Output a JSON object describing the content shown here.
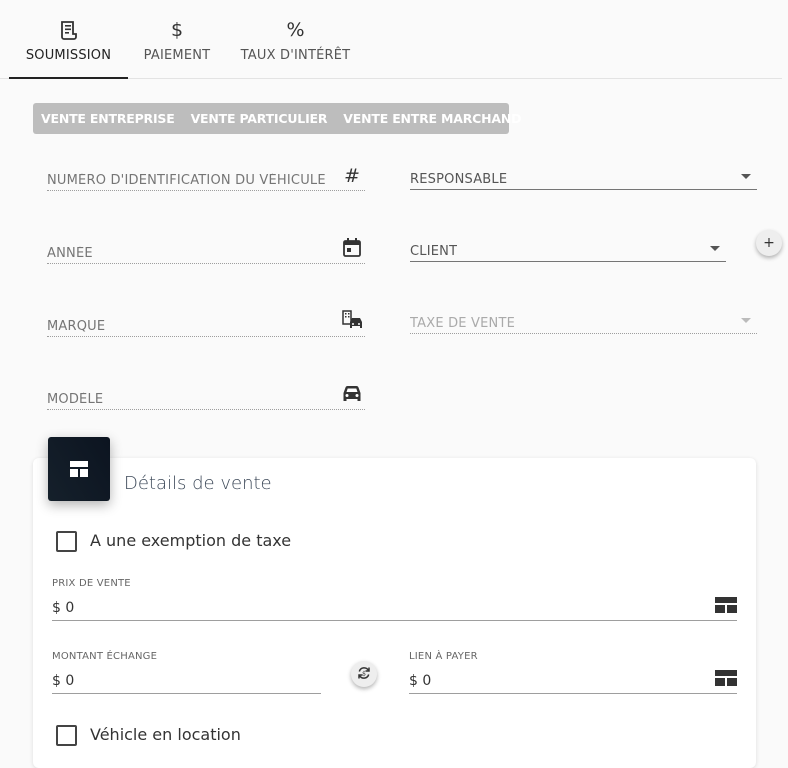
{
  "tabs": [
    {
      "label": "SOUMISSION",
      "icon": "receipt-icon",
      "active": true
    },
    {
      "label": "PAIEMENT",
      "icon": "dollar-icon",
      "glyph": "$",
      "active": false
    },
    {
      "label": "TAUX D'INTÉRÊT",
      "icon": "percent-icon",
      "glyph": "%",
      "active": false
    }
  ],
  "sale_types": [
    "VENTE ENTREPRISE",
    "VENTE PARTICULIER",
    "VENTE ENTRE MARCHAND"
  ],
  "fields": {
    "vin_label": "NUMÉRO D'IDENTIFICATION DU VÉHICULE",
    "vin_icon_glyph": "#",
    "year_label": "ANNÉE",
    "make_label": "MARQUE",
    "model_label": "MODÈLE",
    "responsible_label": "RESPONSABLE",
    "client_label": "CLIENT",
    "sales_tax_label": "TAXE DE VENTE",
    "add_client_glyph": "+"
  },
  "sale_details": {
    "title": "Détails de vente",
    "tax_exemption_label": "A une exemption de taxe",
    "sale_price_label": "PRIX DE VENTE",
    "sale_price_value": "$ 0",
    "trade_in_label": "MONTANT ÉCHANGE",
    "trade_in_value": "$ 0",
    "lien_label": "LIEN À PAYER",
    "lien_value": "$ 0",
    "leased_vehicle_label": "Véhicle en location"
  },
  "colors": {
    "accent": "#222222",
    "sale_type_bg": "#bdbdbd",
    "card_icon_bg": "#15202b"
  }
}
